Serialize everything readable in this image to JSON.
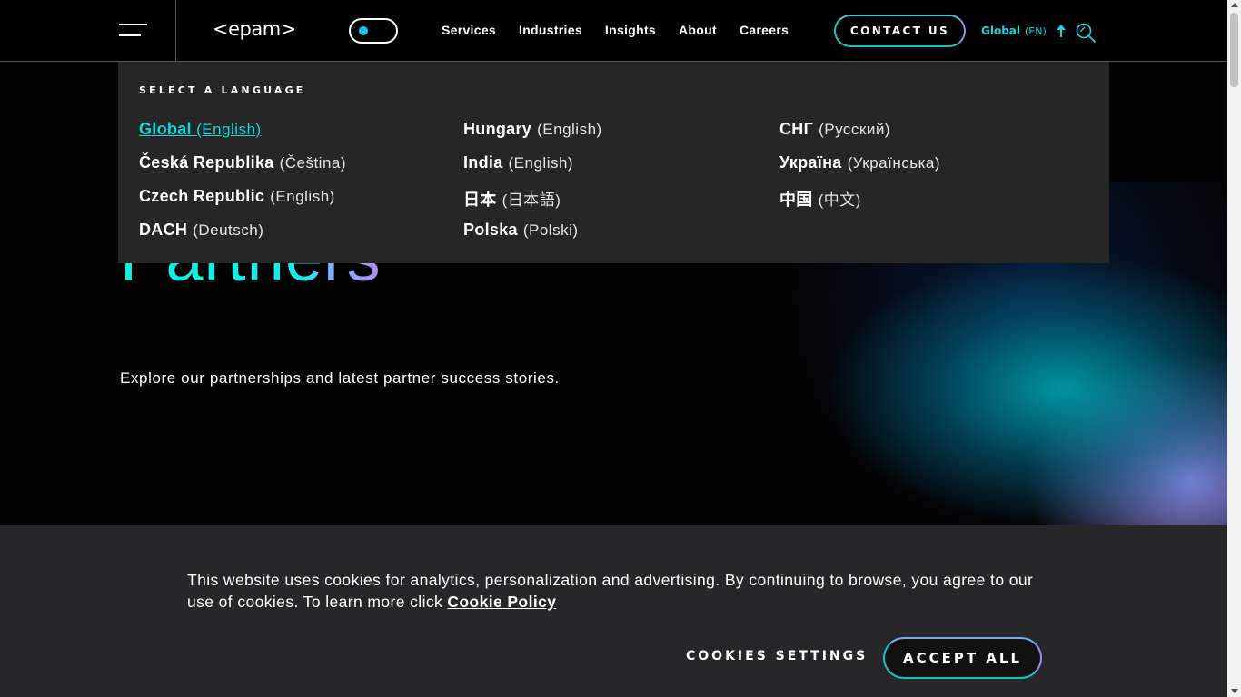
{
  "header": {
    "logo": "<epam>",
    "nav": [
      "Services",
      "Industries",
      "Insights",
      "About",
      "Careers"
    ],
    "contact_label": "CONTACT US",
    "lang_name": "Global",
    "lang_code": "(EN)"
  },
  "lang_panel": {
    "title": "SELECT A LANGUAGE",
    "col1": [
      {
        "country": "Global ",
        "language": "(English)"
      },
      {
        "country": "Česká Republika",
        "language": "(Čeština)"
      },
      {
        "country": "Czech Republic",
        "language": "(English)"
      },
      {
        "country": "DACH",
        "language": "(Deutsch)"
      }
    ],
    "col2": [
      {
        "country": "Hungary",
        "language": "(English)"
      },
      {
        "country": "India",
        "language": "(English)"
      },
      {
        "country": "日本",
        "language": "(日本語)"
      },
      {
        "country": "Polska",
        "language": "(Polski)"
      }
    ],
    "col3": [
      {
        "country": "СНГ",
        "language": "(Русский)"
      },
      {
        "country": "Україна",
        "language": "(Українська)"
      },
      {
        "country": "中国",
        "language": "(中文)"
      }
    ]
  },
  "hero": {
    "title": "Partners",
    "subtitle": "Explore our partnerships and latest partner success stories."
  },
  "cookie": {
    "text": "This website uses cookies for analytics, personalization and advertising. By continuing to browse, you agree to our use of cookies. To learn more click ",
    "link": "Cookie Policy",
    "settings_label": "COOKIES SETTINGS",
    "accept_label": "ACCEPT ALL"
  },
  "colors": {
    "accent": "#16d6de",
    "panel": "#262626",
    "background": "#030304"
  },
  "icons": [
    "hamburger-menu-icon",
    "theme-toggle",
    "arrow-up-icon",
    "search-icon"
  ]
}
